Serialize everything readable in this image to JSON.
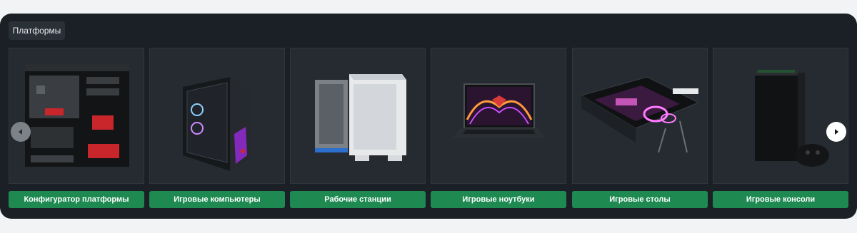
{
  "tab": {
    "label": "Платформы"
  },
  "cards": [
    {
      "label": "Конфигуратор платформы",
      "icon": "pc-case-open-image"
    },
    {
      "label": "Игровые компьютеры",
      "icon": "gaming-pc-image"
    },
    {
      "label": "Рабочие станции",
      "icon": "workstation-image"
    },
    {
      "label": "Игровые ноутбуки",
      "icon": "gaming-laptop-image"
    },
    {
      "label": "Игровые столы",
      "icon": "gaming-desk-image"
    },
    {
      "label": "Игровые консоли",
      "icon": "game-console-image"
    }
  ],
  "colors": {
    "accent": "#1e8a52",
    "panel": "#1b2026",
    "card": "#252b31"
  }
}
